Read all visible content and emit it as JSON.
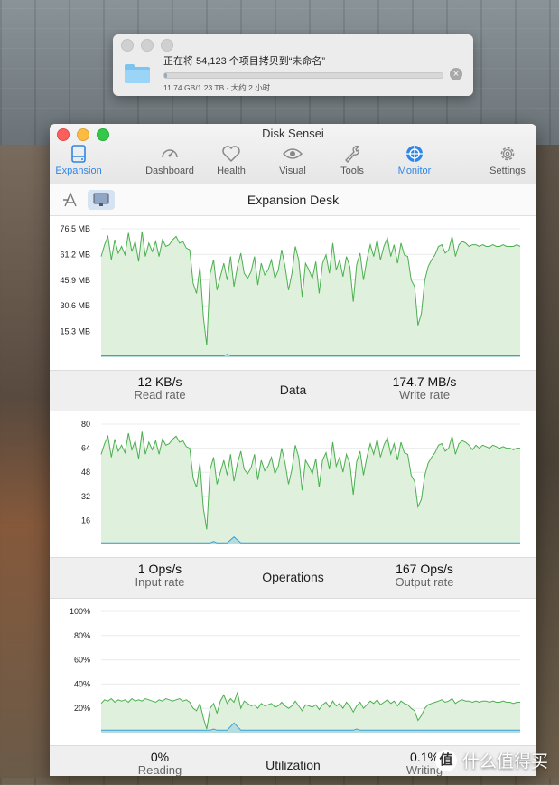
{
  "copy_dialog": {
    "message": "正在将 54,123 个项目拷贝到“未命名”",
    "detail": "11.74 GB/1.23 TB - 大约 2 小时",
    "progress": 0.0095
  },
  "app": {
    "title": "Disk Sensei",
    "tabs": [
      {
        "label": "Expansion",
        "icon": "drive-icon",
        "active": true
      },
      {
        "label": "Dashboard",
        "icon": "speedometer-icon",
        "active": false
      },
      {
        "label": "Health",
        "icon": "heart-icon",
        "active": false
      },
      {
        "label": "Visual",
        "icon": "eye-icon",
        "active": false
      },
      {
        "label": "Tools",
        "icon": "wrench-icon",
        "active": false
      },
      {
        "label": "Monitor",
        "icon": "monitor-target-icon",
        "active": true
      },
      {
        "label": "Settings",
        "icon": "gear-icon",
        "active": false
      }
    ]
  },
  "device": {
    "name": "Expansion Desk",
    "buttons": [
      {
        "icon": "app-store-icon",
        "selected": false
      },
      {
        "icon": "display-icon",
        "selected": true
      }
    ]
  },
  "colors": {
    "accent": "#2f86e6",
    "write_line": "#4caf50",
    "write_fill": "#dff1dc",
    "read_line": "#3aa0d8"
  },
  "panels": {
    "data": {
      "title": "Data",
      "left_value": "12 KB/s",
      "left_label": "Read rate",
      "right_value": "174.7 MB/s",
      "right_label": "Write rate"
    },
    "operations": {
      "title": "Operations",
      "left_value": "1 Ops/s",
      "left_label": "Input rate",
      "right_value": "167 Ops/s",
      "right_label": "Output rate"
    },
    "utilization": {
      "title": "Utilization",
      "left_value": "0%",
      "left_label": "Reading",
      "right_value": "0.1%",
      "right_label": "Writing"
    }
  },
  "chart_data": [
    {
      "type": "area",
      "ylabel_ticks": [
        "76.5 MB",
        "61.2 MB",
        "45.9 MB",
        "30.6 MB",
        "15.3 MB"
      ],
      "ylim": [
        0,
        76.5
      ],
      "series": [
        {
          "values": [
            60,
            67,
            72,
            58,
            70,
            62,
            66,
            61,
            74,
            63,
            69,
            57,
            75,
            60,
            68,
            63,
            69,
            60,
            70,
            66,
            67,
            70,
            72,
            68,
            69,
            65,
            64,
            44,
            38,
            54,
            24,
            7,
            50,
            58,
            40,
            48,
            56,
            46,
            60,
            42,
            54,
            62,
            50,
            47,
            51,
            60,
            43,
            56,
            49,
            52,
            58,
            47,
            52,
            64,
            54,
            40,
            50,
            66,
            58,
            36,
            56,
            52,
            47,
            57,
            38,
            56,
            61,
            50,
            68,
            52,
            58,
            48,
            60,
            54,
            33,
            55,
            62,
            46,
            58,
            67,
            60,
            70,
            58,
            66,
            71,
            60,
            67,
            56,
            68,
            61,
            60,
            46,
            42,
            19,
            26,
            46,
            54,
            58,
            61,
            66,
            67,
            62,
            64,
            72,
            60,
            67,
            69,
            68,
            66,
            67,
            67,
            66,
            67,
            66,
            66,
            67,
            66,
            66,
            67,
            66,
            66,
            66,
            67,
            66
          ]
        },
        {
          "values": [
            0.8,
            0.8,
            0.8,
            0.8,
            0.8,
            0.8,
            0.8,
            0.8,
            0.8,
            0.8,
            0.8,
            0.8,
            0.8,
            0.8,
            0.8,
            0.8,
            0.8,
            0.8,
            0.8,
            0.8,
            0.8,
            0.8,
            0.8,
            0.8,
            0.8,
            0.8,
            0.8,
            0.8,
            0.8,
            0.8,
            0.8,
            0.8,
            0.8,
            0.8,
            0.8,
            0.8,
            0.8,
            1.8,
            0.8,
            0.8,
            0.8,
            0.8,
            0.8,
            0.8,
            0.8,
            0.8,
            0.8,
            0.8,
            0.8,
            0.8,
            0.8,
            0.8,
            0.8,
            0.8,
            0.8,
            0.8,
            0.8,
            0.8,
            0.8,
            0.8,
            0.8,
            0.8,
            0.8,
            0.8,
            0.8,
            0.8,
            0.8,
            0.8,
            0.8,
            0.8,
            0.8,
            0.8,
            0.8,
            0.8,
            0.8,
            0.8,
            0.8,
            0.8,
            0.8,
            0.8,
            0.8,
            0.8,
            0.8,
            0.8,
            0.8,
            0.8,
            0.8,
            0.8,
            0.8,
            0.8,
            0.8,
            0.8,
            0.8,
            0.8,
            0.8,
            0.8,
            0.8,
            0.8,
            0.8,
            0.8,
            0.8,
            0.8,
            0.8,
            0.8,
            0.8,
            0.8,
            0.8,
            0.8,
            0.8,
            0.8,
            0.8,
            0.8,
            0.8,
            0.8,
            0.8,
            0.8,
            0.8,
            0.8,
            0.8,
            0.8,
            0.8,
            0.8,
            0.8,
            0.8
          ]
        }
      ]
    },
    {
      "type": "area",
      "ylabel_ticks": [
        "80",
        "64",
        "48",
        "32",
        "16"
      ],
      "ylim": [
        0,
        80
      ],
      "series": [
        {
          "values": [
            60,
            67,
            72,
            58,
            70,
            62,
            66,
            61,
            74,
            63,
            69,
            57,
            75,
            60,
            68,
            63,
            69,
            60,
            70,
            66,
            67,
            70,
            72,
            68,
            69,
            65,
            64,
            44,
            38,
            54,
            24,
            10,
            50,
            58,
            40,
            48,
            56,
            46,
            60,
            42,
            54,
            62,
            50,
            47,
            51,
            60,
            43,
            56,
            49,
            52,
            58,
            47,
            52,
            64,
            54,
            40,
            50,
            66,
            58,
            36,
            56,
            52,
            47,
            57,
            38,
            56,
            61,
            50,
            68,
            52,
            58,
            48,
            60,
            54,
            33,
            55,
            62,
            46,
            58,
            67,
            60,
            70,
            58,
            66,
            71,
            60,
            67,
            56,
            68,
            61,
            60,
            46,
            42,
            25,
            30,
            46,
            54,
            58,
            61,
            66,
            67,
            62,
            64,
            72,
            60,
            67,
            69,
            68,
            66,
            63,
            66,
            64,
            66,
            65,
            64,
            66,
            65,
            64,
            65,
            64,
            64,
            63,
            64,
            64
          ]
        },
        {
          "values": [
            1,
            1,
            1,
            1,
            1,
            1,
            1,
            1,
            1,
            1,
            1,
            1,
            1,
            1,
            1,
            1,
            1,
            1,
            1,
            1,
            1,
            1,
            1,
            1,
            1,
            1,
            1,
            1,
            1,
            1,
            1,
            1,
            1,
            2,
            1,
            1,
            1,
            1,
            3,
            5,
            3,
            1,
            1,
            1,
            1,
            1,
            1,
            1,
            1,
            1,
            1,
            1,
            1,
            1,
            1,
            1,
            1,
            1,
            1,
            1,
            1,
            1,
            1,
            1,
            1,
            1,
            1,
            1,
            1,
            1,
            1,
            1,
            1,
            1,
            1,
            1,
            1,
            1,
            1,
            1,
            1,
            1,
            1,
            1,
            1,
            1,
            1,
            1,
            1,
            1,
            1,
            1,
            1,
            1,
            1,
            1,
            1,
            1,
            1,
            1,
            1,
            1,
            1,
            1,
            1,
            1,
            1,
            1,
            1,
            1,
            1,
            1,
            1,
            1,
            1,
            1,
            1,
            1,
            1,
            1,
            1,
            1,
            1,
            1
          ]
        }
      ]
    },
    {
      "type": "area",
      "ylabel_ticks": [
        "100%",
        "80%",
        "60%",
        "40%",
        "20%"
      ],
      "ylim": [
        0,
        100
      ],
      "series": [
        {
          "values": [
            24,
            27,
            26,
            28,
            25,
            27,
            26,
            27,
            25,
            28,
            26,
            27,
            26,
            28,
            27,
            26,
            25,
            27,
            26,
            28,
            27,
            26,
            27,
            28,
            26,
            27,
            25,
            20,
            18,
            24,
            12,
            3,
            20,
            24,
            16,
            26,
            31,
            24,
            28,
            25,
            33,
            20,
            26,
            24,
            22,
            23,
            20,
            24,
            22,
            23,
            24,
            21,
            22,
            25,
            22,
            20,
            22,
            26,
            22,
            18,
            23,
            22,
            21,
            23,
            19,
            23,
            25,
            21,
            26,
            22,
            24,
            20,
            25,
            22,
            17,
            22,
            25,
            20,
            23,
            26,
            24,
            27,
            23,
            25,
            27,
            24,
            26,
            22,
            26,
            24,
            23,
            20,
            18,
            10,
            14,
            20,
            23,
            24,
            25,
            26,
            27,
            25,
            26,
            28,
            24,
            26,
            27,
            26,
            26,
            25,
            26,
            25,
            26,
            26,
            25,
            26,
            25,
            25,
            26,
            25,
            25,
            24,
            25,
            25
          ]
        },
        {
          "values": [
            2,
            2,
            2,
            2,
            2,
            2,
            2,
            2,
            2,
            2,
            2,
            2,
            2,
            2,
            2,
            2,
            2,
            2,
            2,
            2,
            2,
            2,
            2,
            2,
            2,
            2,
            2,
            2,
            2,
            2,
            2,
            2,
            2,
            3,
            2,
            2,
            2,
            2,
            5,
            8,
            5,
            2,
            2,
            2,
            2,
            2,
            2,
            2,
            2,
            2,
            2,
            2,
            2,
            2,
            2,
            2,
            2,
            2,
            2,
            2,
            2,
            2,
            2,
            2,
            2,
            2,
            2,
            2,
            2,
            2,
            2,
            2,
            2,
            2,
            2,
            3,
            2,
            2,
            2,
            2,
            2,
            2,
            2,
            2,
            2,
            2,
            2,
            2,
            2,
            2,
            2,
            2,
            2,
            2,
            2,
            2,
            2,
            2,
            2,
            2,
            2,
            2,
            2,
            2,
            2,
            2,
            2,
            2,
            2,
            2,
            2,
            2,
            2,
            2,
            2,
            2,
            2,
            2,
            2,
            2,
            2,
            2,
            2,
            2
          ]
        }
      ]
    }
  ],
  "watermark": {
    "logo": "值",
    "text": "什么值得买"
  }
}
